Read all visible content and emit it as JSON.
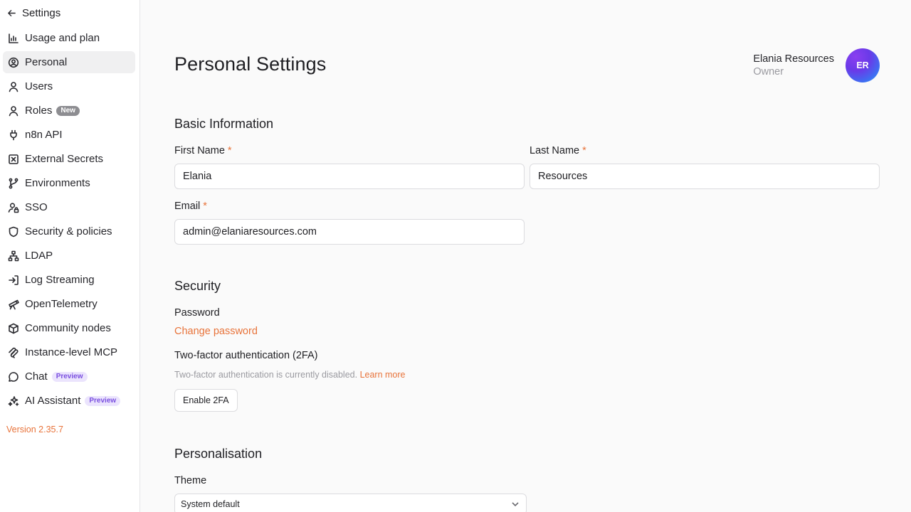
{
  "sidebar": {
    "back_label": "Settings",
    "items": [
      {
        "label": "Usage and plan",
        "icon": "bar-chart-icon"
      },
      {
        "label": "Personal",
        "icon": "user-circle-icon",
        "active": true
      },
      {
        "label": "Users",
        "icon": "user-icon"
      },
      {
        "label": "Roles",
        "icon": "user-icon",
        "badge": "New"
      },
      {
        "label": "n8n API",
        "icon": "plug-icon"
      },
      {
        "label": "External Secrets",
        "icon": "vault-icon"
      },
      {
        "label": "Environments",
        "icon": "git-branch-icon"
      },
      {
        "label": "SSO",
        "icon": "user-lock-icon"
      },
      {
        "label": "Security & policies",
        "icon": "shield-icon"
      },
      {
        "label": "LDAP",
        "icon": "network-icon"
      },
      {
        "label": "Log Streaming",
        "icon": "log-in-icon"
      },
      {
        "label": "OpenTelemetry",
        "icon": "telescope-icon"
      },
      {
        "label": "Community nodes",
        "icon": "box-icon"
      },
      {
        "label": "Instance-level MCP",
        "icon": "mcp-icon"
      },
      {
        "label": "Chat",
        "icon": "chat-bubble-icon",
        "badge": "Preview"
      },
      {
        "label": "AI Assistant",
        "icon": "sparkles-icon",
        "badge": "Preview"
      }
    ],
    "version": "Version 2.35.7"
  },
  "header": {
    "title": "Personal Settings",
    "user_name": "Elania Resources",
    "user_role": "Owner",
    "avatar_initials": "ER"
  },
  "basic": {
    "title": "Basic Information",
    "first_name_label": "First Name",
    "first_name_value": "Elania",
    "last_name_label": "Last Name",
    "last_name_value": "Resources",
    "email_label": "Email",
    "email_value": "admin@elaniaresources.com",
    "required_mark": "*"
  },
  "security": {
    "title": "Security",
    "password_label": "Password",
    "change_password": "Change password",
    "twofa_label": "Two-factor authentication (2FA)",
    "twofa_status": "Two-factor authentication is currently disabled.",
    "learn_more": "Learn more",
    "enable_button": "Enable 2FA"
  },
  "personalisation": {
    "title": "Personalisation",
    "theme_label": "Theme",
    "theme_value": "System default"
  },
  "colors": {
    "accent": "#e8733a",
    "badge_preview_text": "#7a4fe0",
    "badge_preview_bg": "#ebe4fd"
  }
}
